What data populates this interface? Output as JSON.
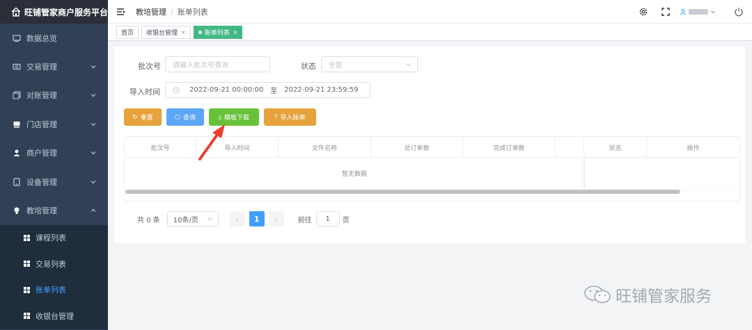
{
  "app": {
    "title": "旺铺管家商户服务平台"
  },
  "sidebar": {
    "items": [
      {
        "label": "数据总览",
        "icon": "dashboard-icon",
        "expandable": false
      },
      {
        "label": "交易管理",
        "icon": "transaction-icon",
        "expandable": true
      },
      {
        "label": "对账管理",
        "icon": "reconcile-icon",
        "expandable": true
      },
      {
        "label": "门店管理",
        "icon": "store-icon",
        "expandable": true
      },
      {
        "label": "商户管理",
        "icon": "user-icon",
        "expandable": true
      },
      {
        "label": "设备管理",
        "icon": "device-icon",
        "expandable": true
      },
      {
        "label": "教培管理",
        "icon": "bulb-icon",
        "expandable": true,
        "expanded": true
      }
    ],
    "subitems": [
      {
        "label": "课程列表",
        "active": false
      },
      {
        "label": "交易列表",
        "active": false
      },
      {
        "label": "账单列表",
        "active": true
      },
      {
        "label": "收银台管理",
        "active": false
      }
    ]
  },
  "header": {
    "breadcrumb": [
      "教培管理",
      "账单列表"
    ],
    "separator": "/"
  },
  "tags": [
    {
      "label": "首页",
      "active": false,
      "closable": false
    },
    {
      "label": "收银台管理",
      "active": false,
      "closable": true
    },
    {
      "label": "账单列表",
      "active": true,
      "closable": true
    }
  ],
  "filters": {
    "batch_label": "批次号",
    "batch_placeholder": "请输入批次号查询",
    "status_label": "状态",
    "status_placeholder": "全部",
    "time_label": "导入时间",
    "time_start": "2022-09-21 00:00:00",
    "time_to": "至",
    "time_end": "2022-09-21 23:59:59"
  },
  "buttons": {
    "reset": "重置",
    "query": "查询",
    "template_download": "模板下载",
    "import_bill": "导入账单"
  },
  "colors": {
    "sidebar_bg": "#304156",
    "accent": "#409eff",
    "reset_btn": "#e6a23c",
    "query_btn": "#409eff",
    "download_btn": "#67c23a",
    "import_btn": "#e6a23c",
    "arrow": "#e8402d"
  },
  "table": {
    "columns": [
      "批次号",
      "导入时间",
      "文件名称",
      "总订单数",
      "完成订单数",
      "",
      "状态",
      "操作"
    ],
    "empty_text": "暂无数据"
  },
  "pagination": {
    "total_text": "共 0 条",
    "page_size": "10条/页",
    "current_page": "1",
    "goto_prefix": "前往",
    "goto_value": "1",
    "goto_suffix": "页"
  },
  "watermark": {
    "text": "旺铺管家服务"
  }
}
